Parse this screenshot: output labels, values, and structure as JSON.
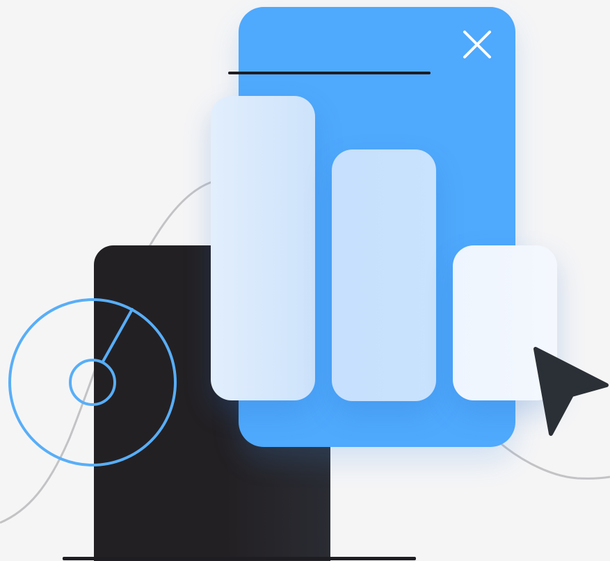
{
  "icons": {
    "close": "close-icon",
    "cursor": "cursor-arrow-icon",
    "dial": "dial-icon"
  },
  "colors": {
    "background": "#f5f5f6",
    "panel_blue": "#4fa9fc",
    "dark_card": "#232023",
    "bar_light": "#cde3fb",
    "dial_stroke": "#58aef7",
    "cursor": "#2b2f36",
    "curve": "#c3c3c6",
    "close_icon": "#ffffff"
  },
  "chart_data": {
    "type": "bar",
    "categories": [
      "",
      "",
      ""
    ],
    "values": [
      438,
      362,
      223
    ]
  }
}
